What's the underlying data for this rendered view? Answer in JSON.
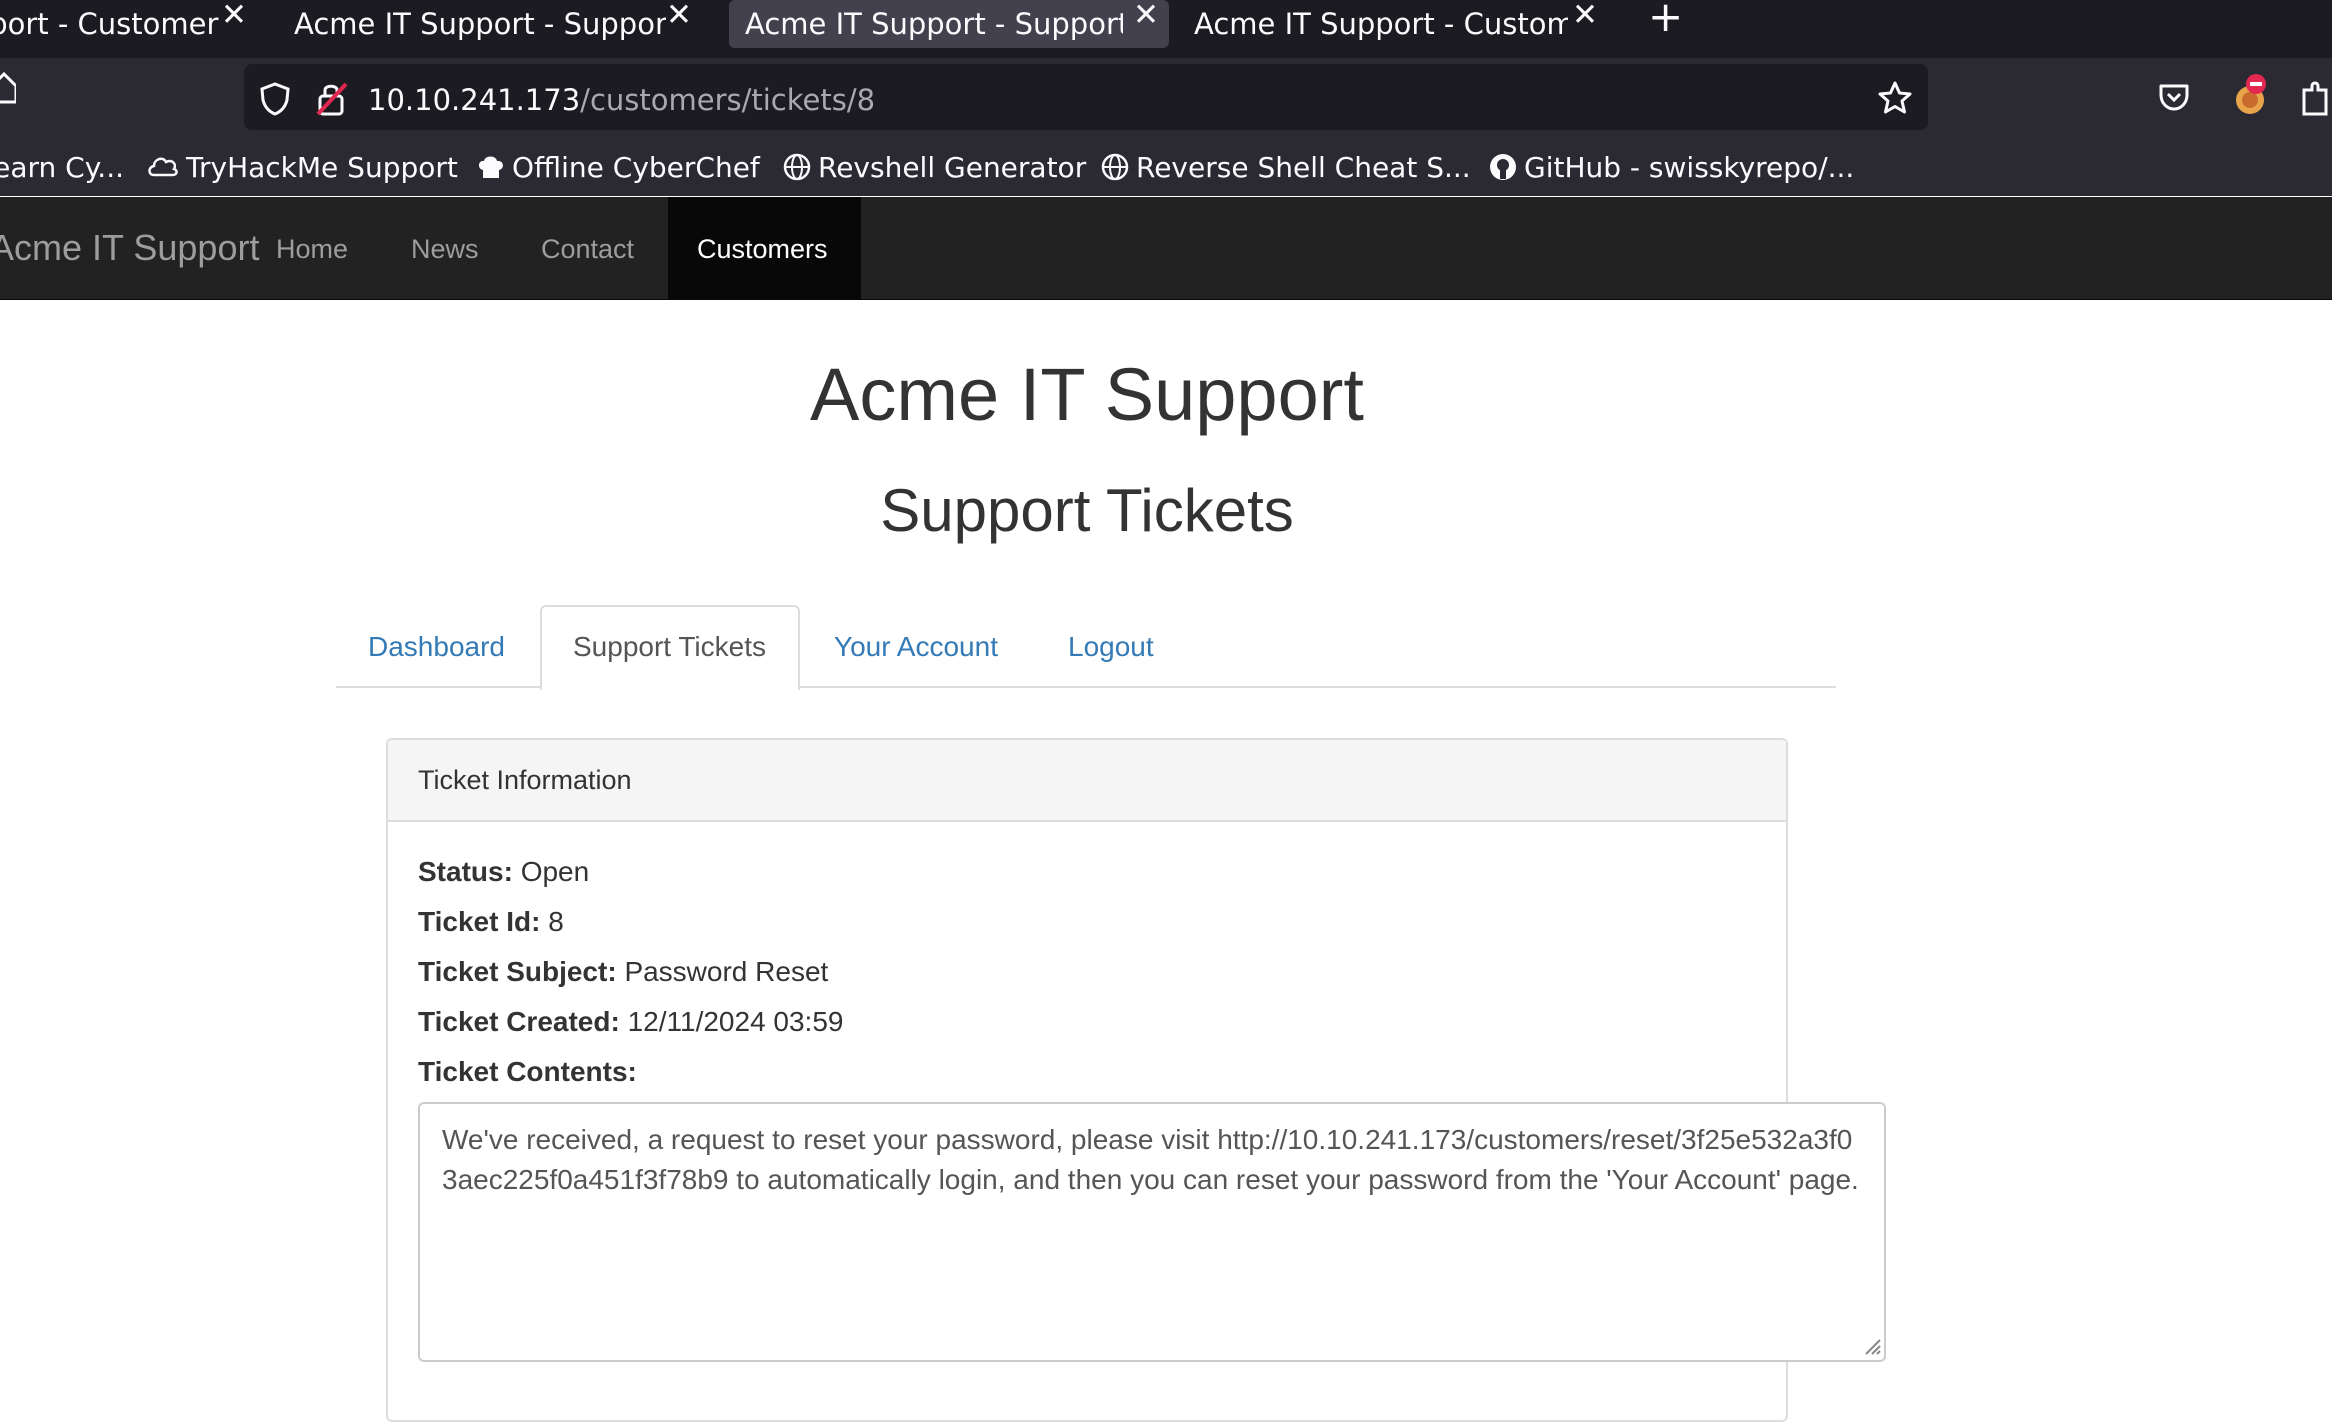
{
  "browser": {
    "tabs": [
      {
        "label": "Support - Customer",
        "active": false
      },
      {
        "label": "Acme IT Support - Support Ti",
        "active": false
      },
      {
        "label": "Acme IT Support - Support Ti",
        "active": true
      },
      {
        "label": "Acme IT Support - Customer",
        "active": false
      }
    ],
    "tab_close_glyph": "✕",
    "new_tab_glyph": "+",
    "url": {
      "host": "10.10.241.173",
      "path": "/customers/tickets/8"
    },
    "bookmarks": [
      {
        "label": "Learn Cy...",
        "icon": "none"
      },
      {
        "label": "TryHackMe Support",
        "icon": "cloud-icon"
      },
      {
        "label": "Offline CyberChef",
        "icon": "chef-hat-icon"
      },
      {
        "label": "Revshell Generator",
        "icon": "globe-icon"
      },
      {
        "label": "Reverse Shell Cheat S...",
        "icon": "globe-icon"
      },
      {
        "label": "GitHub - swisskyrepo/...",
        "icon": "github-icon"
      }
    ]
  },
  "site": {
    "brand": "Acme IT Support",
    "nav": [
      "Home",
      "News",
      "Contact",
      "Customers"
    ],
    "active_nav": "Customers",
    "title": "Acme IT Support",
    "subtitle": "Support Tickets",
    "tabs": [
      "Dashboard",
      "Support Tickets",
      "Your Account",
      "Logout"
    ],
    "active_tab": "Support Tickets",
    "panel": {
      "heading": "Ticket Information",
      "status_label": "Status:",
      "status": "Open",
      "id_label": "Ticket Id:",
      "id": "8",
      "subject_label": "Ticket Subject:",
      "subject": "Password Reset",
      "created_label": "Ticket Created:",
      "created": "12/11/2024 03:59",
      "contents_label": "Ticket Contents:",
      "contents": "We've received, a request to reset your password, please visit http://10.10.241.173/customers/reset/3f25e532a3f03aec225f0a451f3f78b9 to automatically login, and then you can reset your password from the 'Your Account' page."
    },
    "colors": {
      "navbar": "#222222",
      "link": "#337ab7",
      "text": "#333333"
    }
  }
}
